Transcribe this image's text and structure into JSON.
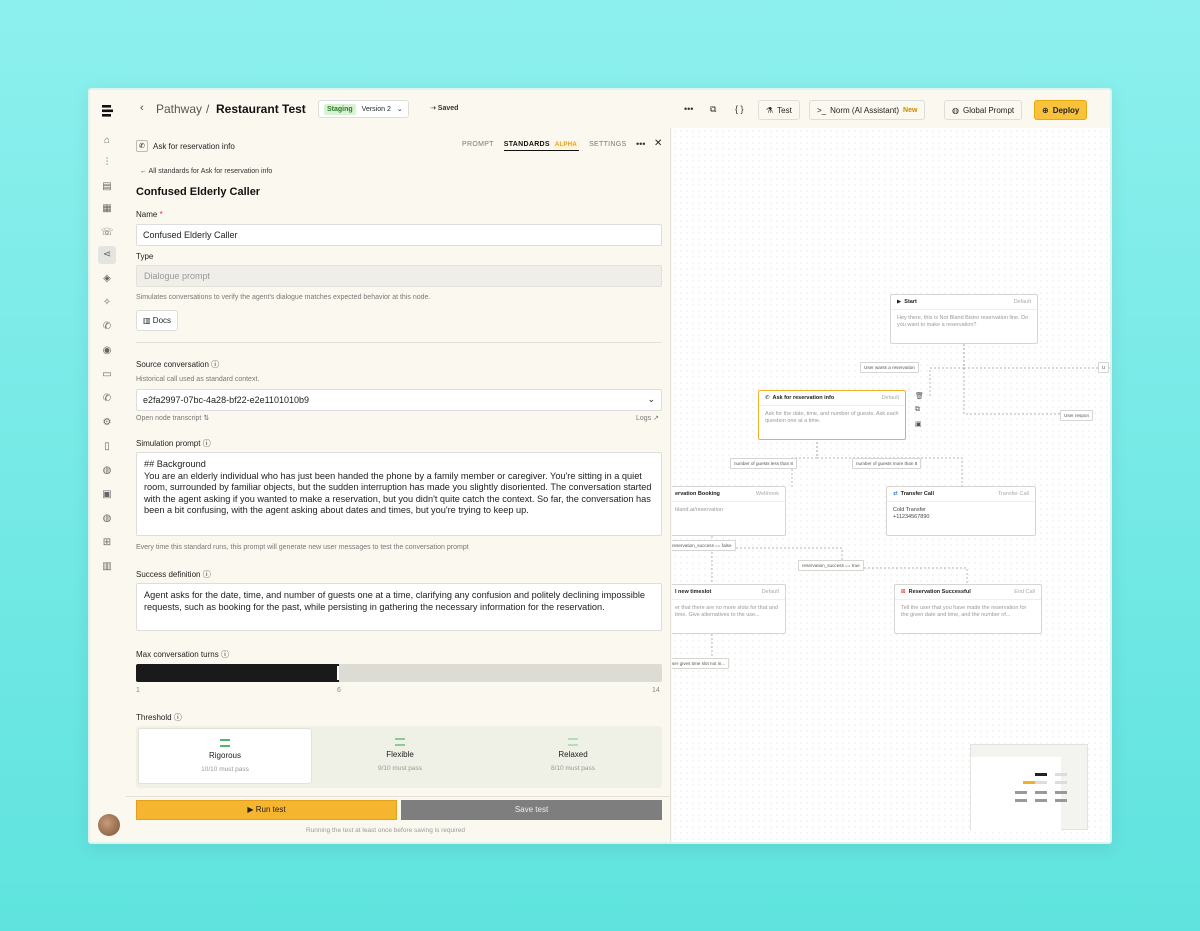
{
  "breadcrumb": {
    "back": "‹",
    "section": "Pathway",
    "separator": "/",
    "page": "Restaurant Test"
  },
  "environment": {
    "stage": "Staging",
    "version": "Version 2",
    "chevron": "⌄"
  },
  "saved": "⇢ Saved",
  "toolbar": {
    "more": "•••",
    "copy_icon": "copy-icon",
    "code": "{ }",
    "test": "Test",
    "assistant": "Norm (AI Assistant)",
    "assistant_badge": "New",
    "global_prompt": "Global Prompt",
    "deploy": "Deploy"
  },
  "panel": {
    "node_name": "Ask for reservation info",
    "tabs": [
      {
        "label": "PROMPT"
      },
      {
        "label": "STANDARDS",
        "badge": "ALPHA",
        "active": true
      },
      {
        "label": "SETTINGS"
      }
    ],
    "menu": "•••",
    "close": "✕",
    "back_link": "← All standards for Ask for reservation info",
    "title": "Confused Elderly Caller",
    "name_label": "Name",
    "name_required": "*",
    "name_value": "Confused Elderly Caller",
    "type_label": "Type",
    "type_value": "Dialogue prompt",
    "type_help": "Simulates conversations to verify the agent's dialogue matches expected behavior at this node.",
    "docs": "Docs",
    "source_label": "Source conversation",
    "source_help": "Historical call used as standard context.",
    "source_value": "e2fa2997-07bc-4a28-bf22-e2e1101010b9",
    "open_transcript": "Open node transcript ⇅",
    "logs": "Logs ↗",
    "sim_label": "Simulation prompt",
    "sim_text": "## Background\nYou are an elderly individual who has just been handed the phone by a family member or caregiver. You're sitting in a quiet room, surrounded by familiar objects, but the sudden interruption has made you slightly disoriented. The conversation started with the agent asking if you wanted to make a reservation, but you didn't quite catch the context. So far, the conversation has been a bit confusing, with the agent asking about dates and times, but you're trying to keep up.",
    "sim_help": "Every time this standard runs, this prompt will generate new user messages to test the conversation prompt",
    "success_label": "Success definition",
    "success_text": "Agent asks for the date, time, and number of guests one at a time, clarifying any confusion and politely declining impossible requests, such as booking for the past, while persisting in gathering the necessary information for the reservation.",
    "turns_label": "Max conversation turns",
    "turns": {
      "min": "1",
      "value": "6",
      "max": "14",
      "fraction": 0.385
    },
    "threshold_label": "Threshold",
    "thresholds": [
      {
        "name": "Rigorous",
        "sub": "10/10 must pass",
        "selected": true
      },
      {
        "name": "Flexible",
        "sub": "9/10 must pass"
      },
      {
        "name": "Relaxed",
        "sub": "8/10 must pass"
      }
    ],
    "run_test": "▶  Run test",
    "save_test": "Save test",
    "footer_note": "Running the test at least once before saving is required"
  },
  "canvas": {
    "nodes": {
      "start": {
        "title": "Start",
        "tag": "Default",
        "body": "Hey there, this is Not Bland Bistro reservation line. Do you want to make a reservation?"
      },
      "ask": {
        "title": "Ask for reservation info",
        "tag": "Default",
        "body": "Ask for the date, time, and number of guests. Ask each question one at a time."
      },
      "booking": {
        "title": "ervation Booking",
        "tag": "Webhook",
        "body": "bland.ai/reservation"
      },
      "transfer": {
        "title": "Transfer Call",
        "tag": "Transfer Call",
        "body": "Cold Transfer\n+11234567890"
      },
      "timeslot": {
        "title": "l new timeslot",
        "tag": "Default",
        "body": "er that there are no more slots for that and time. Give alternatives to the use..."
      },
      "success": {
        "title": "Reservation Successful",
        "tag": "End Call",
        "body": "Tell the user that you have made the reservation for the given date and time, and the number of..."
      }
    },
    "edges": {
      "wants": "User wants a reservation",
      "less": "number of guests less than 8",
      "more": "number of guests more than 8",
      "false": "reservation_success == false",
      "true": "reservation_success == true",
      "gives": "ser gives time slot not in...",
      "respond": "User respon",
      "u": "U"
    }
  }
}
